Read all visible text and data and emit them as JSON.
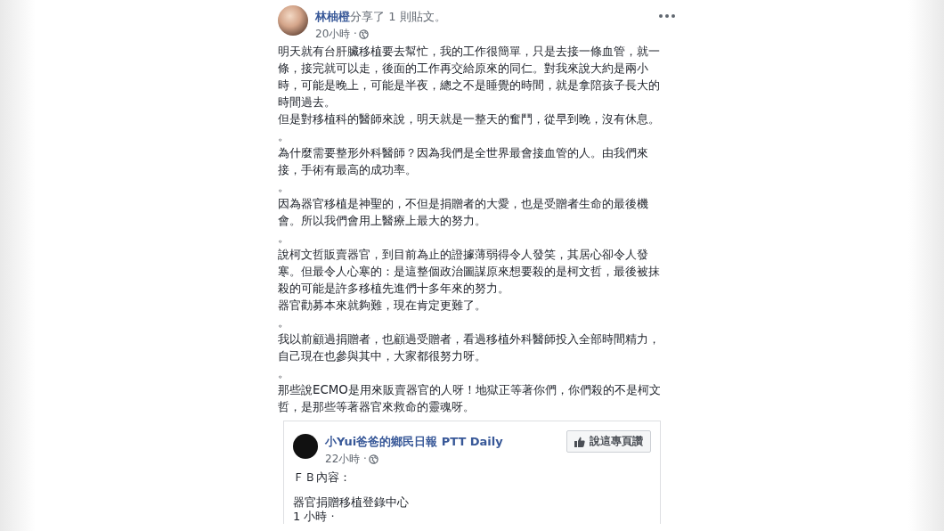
{
  "post": {
    "author": "林柚橙",
    "action": "分享了 1 則貼文。",
    "time": "20小時 · ",
    "paragraphs": [
      "明天就有台肝臟移植要去幫忙，我的工作很簡單，只是去接一條血管，就一條，接完就可以走，後面的工作再交給原來的同仁。對我來說大約是兩小時，可能是晚上，可能是半夜，總之不是睡覺的時間，就是拿陪孩子長大的時間過去。",
      "但是對移植科的醫師來說，明天就是一整天的奮鬥，從早到晚，沒有休息。",
      "。",
      "為什麼需要整形外科醫師？因為我們是全世界最會接血管的人。由我們來接，手術有最高的成功率。",
      "。",
      "因為器官移植是神聖的，不但是捐贈者的大愛，也是受贈者生命的最後機會。所以我們會用上醫療上最大的努力。",
      "。",
      "說柯文哲販賣器官，到目前為止的證據薄弱得令人發笑，其居心卻令人發寒。但最令人心寒的：是這整個政治圖謀原來想要殺的是柯文哲，最後被抹殺的可能是許多移植先進們十多年來的努力。",
      "器官勸募本來就夠難，現在肯定更難了。",
      "。",
      "我以前顧過捐贈者，也顧過受贈者，看過移植外科醫師投入全部時間精力，自己現在也參與其中，大家都很努力呀。",
      "。",
      "那些說ECMO是用來販賣器官的人呀！地獄正等著你們，你們殺的不是柯文哲，是那些等著器官來救命的靈魂呀。"
    ],
    "shared": {
      "page_name": "小Yui爸爸的鄉民日報 PTT Daily",
      "time": "22小時 · ",
      "like_button": "說這專頁讚",
      "lines": [
        "ＦＢ內容：",
        "器官捐贈移植登錄中心",
        "1 小時 · "
      ]
    }
  }
}
